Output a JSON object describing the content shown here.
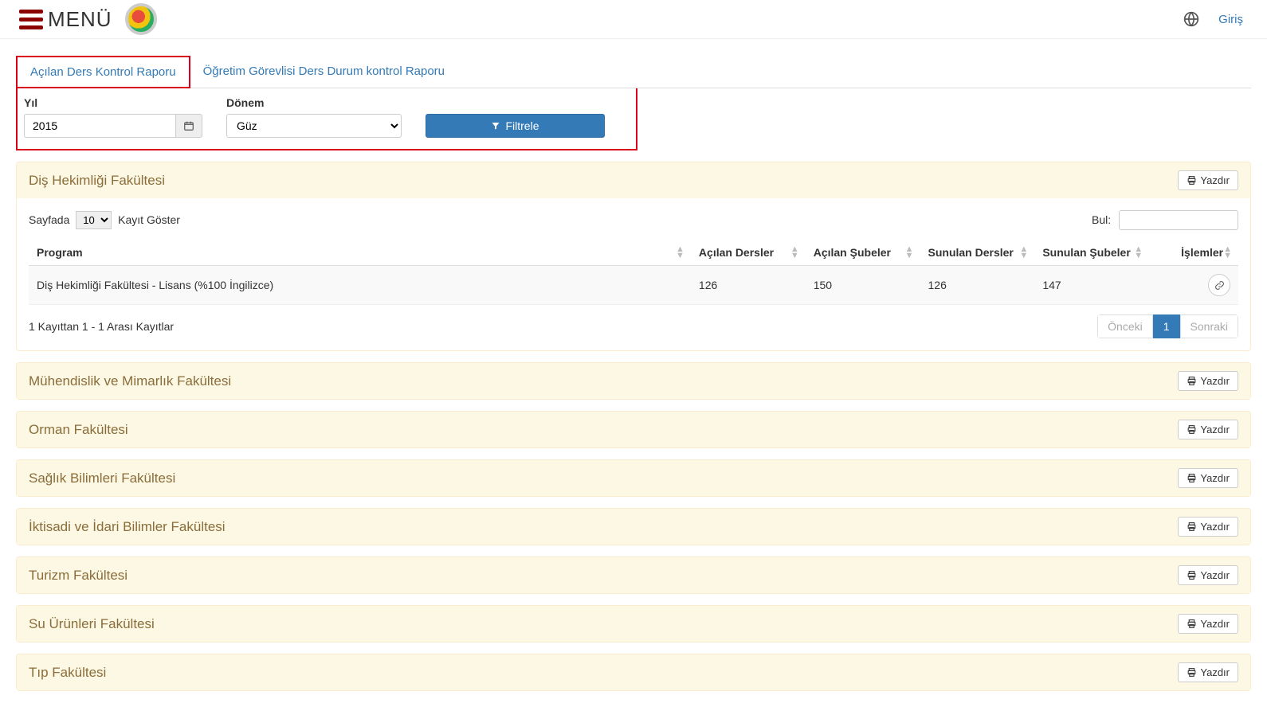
{
  "header": {
    "menu_label": "MENÜ",
    "login_label": "Giriş"
  },
  "tabs": {
    "active": "Açılan Ders Kontrol Raporu",
    "other": "Öğretim Görevlisi Ders Durum kontrol Raporu"
  },
  "filter": {
    "year_label": "Yıl",
    "year_value": "2015",
    "term_label": "Dönem",
    "term_value": "Güz",
    "button_label": "Filtrele"
  },
  "print_label": "Yazdır",
  "datatable": {
    "length_prefix": "Sayfada",
    "length_value": "10",
    "length_suffix": "Kayıt Göster",
    "search_label": "Bul:",
    "columns": {
      "program": "Program",
      "acilan_dersler": "Açılan Dersler",
      "acilan_subeler": "Açılan Şubeler",
      "sunulan_dersler": "Sunulan Dersler",
      "sunulan_subeler": "Sunulan Şubeler",
      "islemler": "İşlemler"
    },
    "row": {
      "program": "Diş Hekimliği Fakültesi - Lisans (%100 İngilizce)",
      "acilan_dersler": "126",
      "acilan_subeler": "150",
      "sunulan_dersler": "126",
      "sunulan_subeler": "147"
    },
    "info": "1 Kayıttan 1 - 1 Arası Kayıtlar",
    "prev": "Önceki",
    "page": "1",
    "next": "Sonraki"
  },
  "faculties": [
    "Diş Hekimliği Fakültesi",
    "Mühendislik ve Mimarlık Fakültesi",
    "Orman Fakültesi",
    "Sağlık Bilimleri Fakültesi",
    "İktisadi ve İdari Bilimler Fakültesi",
    "Turizm Fakültesi",
    "Su Ürünleri Fakültesi",
    "Tıp Fakültesi"
  ]
}
